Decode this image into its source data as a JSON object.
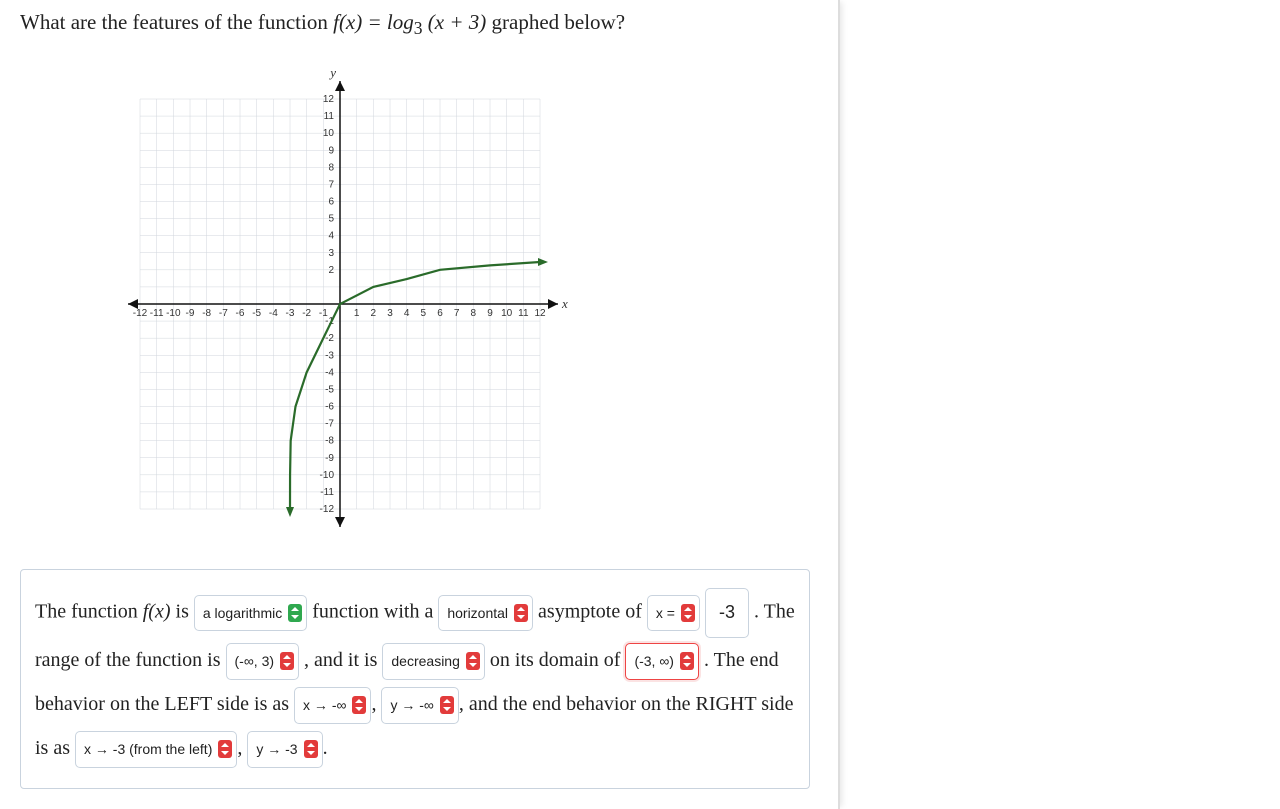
{
  "question": {
    "prefix": "What are the features of the function ",
    "fn_lhs": "f(x) = log",
    "fn_base": "3",
    "fn_arg": " (x + 3)",
    "suffix": " graphed below?"
  },
  "chart_data": {
    "type": "line",
    "title": "",
    "xlabel": "x",
    "ylabel": "y",
    "xlim": [
      -12,
      12
    ],
    "ylim": [
      -12,
      12
    ],
    "x_ticks": [
      -12,
      -11,
      -10,
      -9,
      -8,
      -7,
      -6,
      -5,
      -4,
      -3,
      -2,
      -1,
      1,
      2,
      3,
      4,
      5,
      6,
      7,
      8,
      9,
      10,
      11,
      12
    ],
    "y_ticks": [
      -12,
      -11,
      -10,
      -9,
      -8,
      -7,
      -6,
      -5,
      -4,
      -3,
      -2,
      -1,
      2,
      3,
      4,
      5,
      6,
      7,
      8,
      9,
      10,
      11,
      12
    ],
    "asymptote_x": -3,
    "series": [
      {
        "name": "f(x)=log3(x+3)",
        "points": [
          {
            "x": -2.9995,
            "y": -12
          },
          {
            "x": -2.996,
            "y": -10
          },
          {
            "x": -2.96,
            "y": -8
          },
          {
            "x": -2.67,
            "y": -6
          },
          {
            "x": -2.0,
            "y": -4
          },
          {
            "x": -1.0,
            "y": -2
          },
          {
            "x": 0,
            "y": 0
          },
          {
            "x": 2,
            "y": 1
          },
          {
            "x": 4,
            "y": 1.46
          },
          {
            "x": 6,
            "y": 2
          },
          {
            "x": 9,
            "y": 2.26
          },
          {
            "x": 12,
            "y": 2.46
          }
        ]
      }
    ]
  },
  "answer": {
    "line1_a": "The function ",
    "fn_name": "f(x)",
    "line1_b": " is ",
    "sel1": "a logarithmic",
    "line1_c": " function with a ",
    "sel2": "horizontal",
    "line1_d": " asymptote of ",
    "sel3": "x =",
    "num1": "-3",
    "line2_a": " . The range of the function is ",
    "sel4": "(-∞, 3)",
    "line2_b": ", and it is ",
    "sel5": "decreasing",
    "line2_c": " on its domain of ",
    "sel6": "(-3, ∞)",
    "line3_a": ". The end behavior on the LEFT side is as ",
    "sel7": "x → -∞",
    "line3_b": ", ",
    "sel8": "y → -∞",
    "line3_c": ", and the end behavior on the RIGHT side is as ",
    "sel9": "x → -3 (from the left)",
    "line3_d": ", ",
    "sel10": "y → -3",
    "line3_e": "."
  }
}
